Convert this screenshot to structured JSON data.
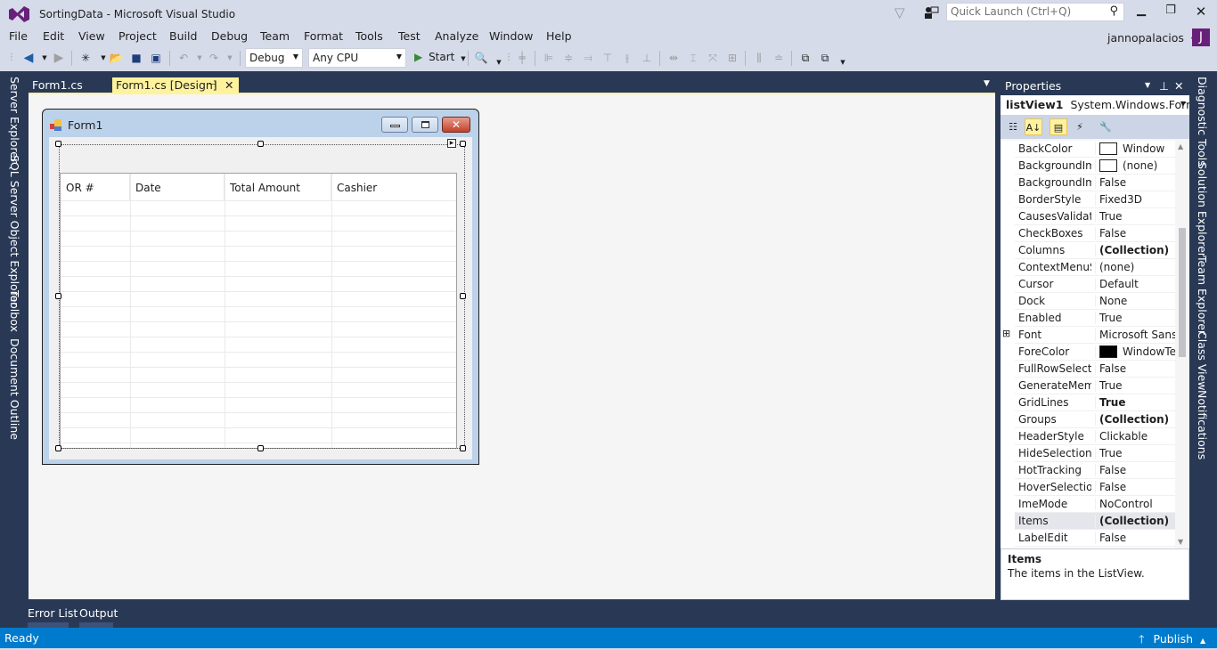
{
  "window": {
    "title": "SortingData - Microsoft Visual Studio",
    "quick_launch_placeholder": "Quick Launch (Ctrl+Q)",
    "user": "jannopalacios",
    "avatar_initial": "J"
  },
  "menu": [
    "File",
    "Edit",
    "View",
    "Project",
    "Build",
    "Debug",
    "Team",
    "Format",
    "Tools",
    "Test",
    "Analyze",
    "Window",
    "Help"
  ],
  "toolbar": {
    "config": "Debug",
    "platform": "Any CPU",
    "start": "Start"
  },
  "left_tabs": [
    "Server Explorer",
    "SQL Server Object Explorer",
    "Toolbox",
    "Document Outline"
  ],
  "right_tabs": [
    "Diagnostic Tools",
    "Solution Explorer",
    "Team Explorer",
    "Class View",
    "Notifications"
  ],
  "doc_tabs": [
    {
      "label": "Form1.cs",
      "active": false
    },
    {
      "label": "Form1.cs [Design]",
      "active": true
    }
  ],
  "form": {
    "title": "Form1",
    "listview_columns": [
      "OR #",
      "Date",
      "Total Amount",
      "Cashier"
    ]
  },
  "properties": {
    "header": "Properties",
    "object_name": "listView1",
    "object_type": "System.Windows.Forms.l",
    "rows": [
      {
        "name": "BackColor",
        "value": "Window",
        "swatch": "#ffffff"
      },
      {
        "name": "BackgroundIma",
        "value": "(none)",
        "swatch": "#ffffff"
      },
      {
        "name": "BackgroundIma",
        "value": "False"
      },
      {
        "name": "BorderStyle",
        "value": "Fixed3D"
      },
      {
        "name": "CausesValidatio",
        "value": "True"
      },
      {
        "name": "CheckBoxes",
        "value": "False"
      },
      {
        "name": "Columns",
        "value": "(Collection)",
        "bold": true
      },
      {
        "name": "ContextMenuSt",
        "value": "(none)"
      },
      {
        "name": "Cursor",
        "value": "Default"
      },
      {
        "name": "Dock",
        "value": "None"
      },
      {
        "name": "Enabled",
        "value": "True"
      },
      {
        "name": "Font",
        "value": "Microsoft Sans S",
        "expandable": true
      },
      {
        "name": "ForeColor",
        "value": "WindowTex",
        "swatch": "#000000"
      },
      {
        "name": "FullRowSelect",
        "value": "False"
      },
      {
        "name": "GenerateMemb",
        "value": "True"
      },
      {
        "name": "GridLines",
        "value": "True",
        "bold": true
      },
      {
        "name": "Groups",
        "value": "(Collection)",
        "bold": true
      },
      {
        "name": "HeaderStyle",
        "value": "Clickable"
      },
      {
        "name": "HideSelection",
        "value": "True"
      },
      {
        "name": "HotTracking",
        "value": "False"
      },
      {
        "name": "HoverSelection",
        "value": "False"
      },
      {
        "name": "ImeMode",
        "value": "NoControl"
      },
      {
        "name": "Items",
        "value": "(Collection)",
        "bold": true,
        "selected": true
      },
      {
        "name": "LabelEdit",
        "value": "False"
      }
    ],
    "description_title": "Items",
    "description_text": "The items in the ListView."
  },
  "bottom_tabs": [
    "Error List",
    "Output"
  ],
  "status": {
    "text": "Ready",
    "publish": "Publish"
  }
}
